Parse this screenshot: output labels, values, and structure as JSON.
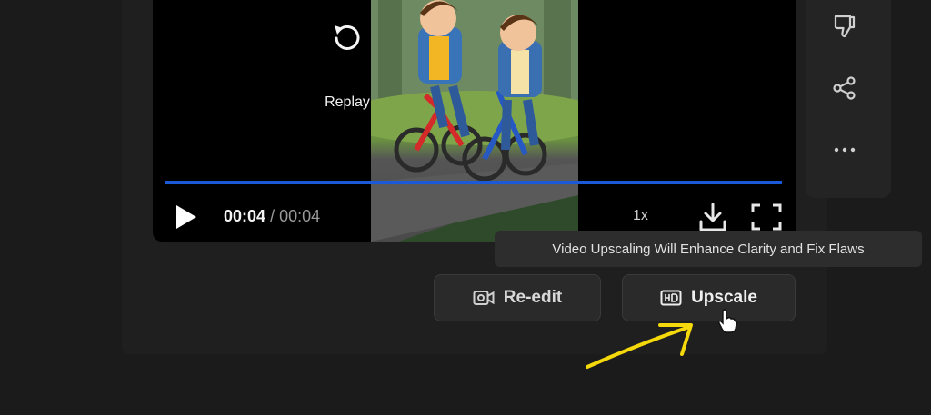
{
  "player": {
    "replay_label": "Replay",
    "time_current": "00:04",
    "time_separator": "/",
    "time_total": "00:04",
    "speed": "1x",
    "progress": 1.0
  },
  "tooltip": {
    "text": "Video Upscaling Will Enhance Clarity and Fix Flaws"
  },
  "actions": {
    "reedit_label": "Re-edit",
    "upscale_label": "Upscale"
  },
  "side_actions": [
    "thumbs-down-icon",
    "share-icon",
    "more-icon"
  ],
  "colors": {
    "background": "#1b1b1b",
    "progress": "#1a5ad6",
    "annotation": "#f5d90a"
  }
}
